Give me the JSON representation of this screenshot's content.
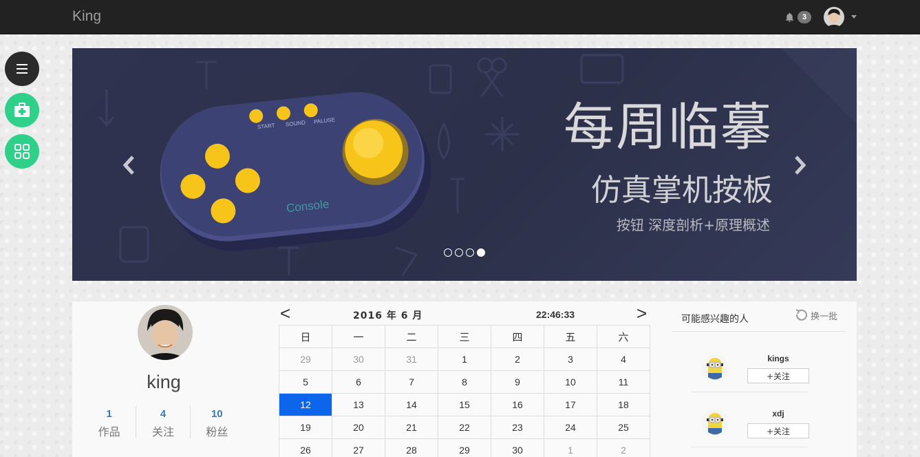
{
  "navbar": {
    "brand": "King",
    "notification_count": "3"
  },
  "side_buttons": [
    "menu-icon",
    "first-aid-icon",
    "apps-grid-icon"
  ],
  "carousel": {
    "headline": "每周临摹",
    "subheadline": "仿真掌机按板",
    "tagline": "按钮 深度剖析+原理概述",
    "console_buttons": [
      "START",
      "SOUND",
      "PALUSE"
    ],
    "console_label": "Console",
    "slides": 4,
    "active_slide": 4
  },
  "profile": {
    "name": "king",
    "stats": [
      {
        "count": "1",
        "label": "作品"
      },
      {
        "count": "4",
        "label": "关注"
      },
      {
        "count": "10",
        "label": "粉丝"
      }
    ]
  },
  "calendar": {
    "prev_label": "<",
    "next_label": ">",
    "month_label": "2016 年 6 月",
    "time": "22:46:33",
    "weekdays": [
      "日",
      "一",
      "二",
      "三",
      "四",
      "五",
      "六"
    ],
    "weeks": [
      [
        "29",
        "30",
        "31",
        "1",
        "2",
        "3",
        "4"
      ],
      [
        "5",
        "6",
        "7",
        "8",
        "9",
        "10",
        "11"
      ],
      [
        "12",
        "13",
        "14",
        "15",
        "16",
        "17",
        "18"
      ],
      [
        "19",
        "20",
        "21",
        "22",
        "23",
        "24",
        "25"
      ],
      [
        "26",
        "27",
        "28",
        "29",
        "30",
        "1",
        "2"
      ]
    ],
    "muted": [
      [
        0,
        0
      ],
      [
        0,
        1
      ],
      [
        0,
        2
      ],
      [
        4,
        5
      ],
      [
        4,
        6
      ]
    ],
    "today": [
      2,
      0
    ]
  },
  "recommendations": {
    "title": "可能感兴趣的人",
    "refresh_label": "换一批",
    "people": [
      {
        "name": "kings",
        "follow_label": "+关注"
      },
      {
        "name": "xdj",
        "follow_label": "+关注"
      }
    ]
  },
  "colors": {
    "navbar": "#222222",
    "accent_green": "#2fd08a",
    "link_blue": "#337ab7",
    "today_blue": "#0b66ec",
    "banner_bg": "#2f3350",
    "console_yellow": "#f7c51a"
  }
}
